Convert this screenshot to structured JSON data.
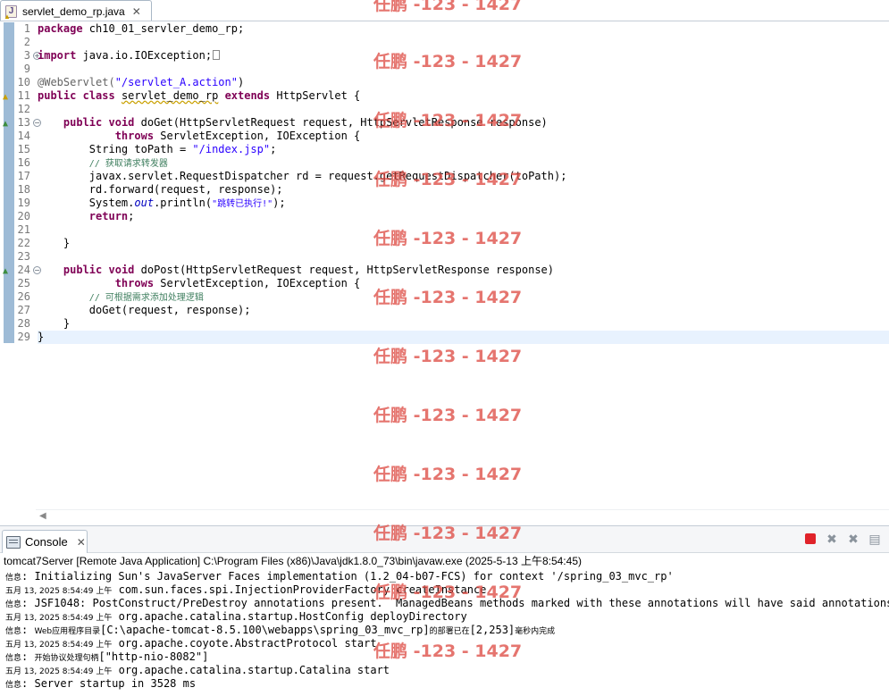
{
  "editor": {
    "tab": {
      "label": "servlet_demo_rp.java",
      "close_glyph": "✕",
      "icon": "java-file-warning-icon"
    },
    "lines": [
      {
        "num": "1"
      },
      {
        "num": "2"
      },
      {
        "num": "3"
      },
      {
        "num": "9"
      },
      {
        "num": "10"
      },
      {
        "num": "11"
      },
      {
        "num": "12"
      },
      {
        "num": "13"
      },
      {
        "num": "14"
      },
      {
        "num": "15"
      },
      {
        "num": "16"
      },
      {
        "num": "17"
      },
      {
        "num": "18"
      },
      {
        "num": "19"
      },
      {
        "num": "20"
      },
      {
        "num": "21"
      },
      {
        "num": "22"
      },
      {
        "num": "23"
      },
      {
        "num": "24"
      },
      {
        "num": "25"
      },
      {
        "num": "26"
      },
      {
        "num": "27"
      },
      {
        "num": "28"
      },
      {
        "num": "29"
      }
    ],
    "code": {
      "l1_kw": "package",
      "l1_rest": " ch10_01_servler_demo_rp;",
      "l3_kw": "import",
      "l3_rest": " java.io.IOException;",
      "l10_ann": "@WebServlet(",
      "l10_str": "\"/servlet_A.action\"",
      "l10_end": ")",
      "l11_kw1": "public",
      "l11_kw2": "class",
      "l11_name": "servlet_demo_rp",
      "l11_kw3": "extends",
      "l11_rest": " HttpServlet {",
      "l13_kw1": "public",
      "l13_kw2": "void",
      "l13_rest": " doGet(HttpServletRequest request, HttpServletResponse response)",
      "l14_kw": "throws",
      "l14_rest": " ServletException, IOException {",
      "l15_a": "        String toPath = ",
      "l15_str": "\"/index.jsp\"",
      "l15_b": ";",
      "l16_cmt": "// 获取请求转发器",
      "l17": "        javax.servlet.RequestDispatcher rd = request.getRequestDispatcher(toPath);",
      "l18": "        rd.forward(request, response);",
      "l19_a": "        System.",
      "l19_out": "out",
      "l19_b": ".println(",
      "l19_str": "\"跳转已执行!\"",
      "l19_c": ");",
      "l20_kw": "return",
      "l20_b": ";",
      "l22": "    }",
      "l24_kw1": "public",
      "l24_kw2": "void",
      "l24_rest": " doPost(HttpServletRequest request, HttpServletResponse response)",
      "l25_kw": "throws",
      "l25_rest": " ServletException, IOException {",
      "l26_cmt": "// 可根据需求添加处理逻辑",
      "l27": "        doGet(request, response);",
      "l28": "    }",
      "l29": "}"
    }
  },
  "console": {
    "tab_label": "Console",
    "tab_close": "✕",
    "toolbar": [
      "terminate-icon",
      "remove-launch-icon",
      "remove-all-terminated-icon",
      "clear-console-icon"
    ],
    "header": "tomcat7Server [Remote Java Application] C:\\Program Files (x86)\\Java\\jdk1.8.0_73\\bin\\javaw.exe  (2025-5-13 上午8:54:45)",
    "lines": [
      {
        "lvl": "信息",
        "text": ": Initializing Sun's JavaServer Faces implementation (1.2_04-b07-FCS) for context '/spring_03_mvc_rp'"
      },
      {
        "date": "五月 13, 2025 8:54:49 ",
        "ampm": "上午",
        "text": " com.sun.faces.spi.InjectionProviderFactory createInstance"
      },
      {
        "lvl": "信息",
        "text": ": JSF1048: PostConstruct/PreDestroy annotations present.  ManagedBeans methods marked with these annotations will have said annotations pro"
      },
      {
        "date": "五月 13, 2025 8:54:49 ",
        "ampm": "上午",
        "text": " org.apache.catalina.startup.HostConfig deployDirectory"
      },
      {
        "lvl": "信息",
        "text_a": ": ",
        "cjk1": "Web应用程序目录",
        "text_b": "[C:\\apache-tomcat-8.5.100\\webapps\\spring_03_mvc_rp]",
        "cjk2": "的部署已在",
        "text_c": "[2,253]",
        "cjk3": "毫秒内完成"
      },
      {
        "date": "五月 13, 2025 8:54:49 ",
        "ampm": "上午",
        "text": " org.apache.coyote.AbstractProtocol start"
      },
      {
        "lvl": "信息",
        "text_a": ": ",
        "cjk1": "开始协议处理句柄",
        "text_b": "[\"http-nio-8082\"]"
      },
      {
        "date": "五月 13, 2025 8:54:49 ",
        "ampm": "上午",
        "text": " org.apache.catalina.startup.Catalina start"
      },
      {
        "lvl": "信息",
        "text": ": Server startup in 3528 ms"
      }
    ]
  },
  "watermark": {
    "text": "任鹏 -123 - 1427"
  }
}
